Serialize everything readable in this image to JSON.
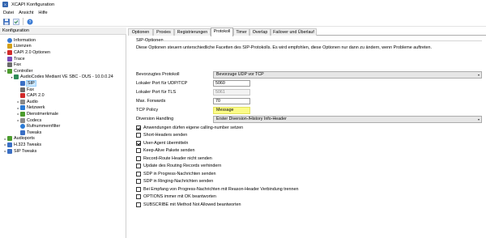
{
  "window": {
    "title": "XCAPI Konfiguration"
  },
  "menu": [
    "Datei",
    "Ansicht",
    "Hilfe"
  ],
  "toolbar": [
    "save-icon",
    "apply-icon",
    "help-icon"
  ],
  "left": {
    "header": "Konfiguration",
    "tree": [
      {
        "label": "Information",
        "icon": "info-icon",
        "color": "#3a7bd5"
      },
      {
        "label": "Lizenzen",
        "icon": "key-icon",
        "color": "#d4a017"
      },
      {
        "label": "CAPI 2.0 Optionen",
        "icon": "capi-icon",
        "color": "#d12a2a"
      },
      {
        "label": "Trace",
        "icon": "trace-icon",
        "color": "#7a4fb8"
      },
      {
        "label": "Fax",
        "icon": "fax-icon",
        "color": "#6d6d6d"
      },
      {
        "label": "Controller",
        "icon": "controller-icon",
        "color": "#4c9c2e"
      },
      {
        "label": "AudioCodes Mediant VE SBC - DUS - 10.0.0.24",
        "icon": "device-icon",
        "color": "#2e8b57"
      },
      {
        "label": "SIP",
        "icon": "sip-icon",
        "color": "#3a6fc4"
      },
      {
        "label": "Fax",
        "icon": "fax-icon",
        "color": "#6d6d6d"
      },
      {
        "label": "CAPI 2.0",
        "icon": "capi-icon",
        "color": "#d12a2a"
      },
      {
        "label": "Audio",
        "icon": "audio-icon",
        "color": "#8a8a8a"
      },
      {
        "label": "Netzwerk",
        "icon": "network-icon",
        "color": "#2b7bd6"
      },
      {
        "label": "Dienstmerkmale",
        "icon": "features-icon",
        "color": "#4c9c2e"
      },
      {
        "label": "Codecs",
        "icon": "codecs-icon",
        "color": "#8a8a8a"
      },
      {
        "label": "Rufnummernfilter",
        "icon": "filter-icon",
        "color": "#2b7bd6"
      },
      {
        "label": "Tweaks",
        "icon": "tweaks-icon",
        "color": "#3a6fc4"
      },
      {
        "label": "Audioports",
        "icon": "audioports-icon",
        "color": "#4c9c2e"
      },
      {
        "label": "H.323 Tweaks",
        "icon": "h323-icon",
        "color": "#3a6fc4"
      },
      {
        "label": "SIP Tweaks",
        "icon": "sip-tweaks-icon",
        "color": "#3a6fc4"
      }
    ]
  },
  "tabs": [
    "Optionen",
    "Proxies",
    "Registrierungen",
    "Protokoll",
    "Timer",
    "Overlap",
    "Failover und Überlauf"
  ],
  "active_tab": "Protokoll",
  "panel": {
    "section_title": "SIP-Optionen",
    "description": "Diese Optionen steuern unterschiedliche Facetten des SIP-Protokolls. Es wird empfohlen, diese Optionen nur dann zu ändern, wenn Probleme auftreten.",
    "fields": {
      "protocol_label": "Bevorzugtes Protokoll",
      "protocol_value": "Bevorzuge UDP vor TCP",
      "udp_tcp_port_label": "Lokaler Port für UDP/TCP",
      "udp_tcp_port_value": "5060",
      "tls_port_label": "Lokaler Port für TLS",
      "tls_port_value": "5061",
      "max_forwards_label": "Max. Forwards",
      "max_forwards_value": "70",
      "tcp_policy_label": "TCP Policy",
      "tcp_policy_value": "Message",
      "diversion_label": "Diversion Handling",
      "diversion_value": "Erster Diversion-/History Info-Header"
    },
    "checkboxes": [
      {
        "label": "Anwendungen dürfen eigene calling-number setzen",
        "checked": true
      },
      {
        "label": "Short-Headers senden",
        "checked": false
      },
      {
        "label": "User-Agent übermitteln",
        "checked": true
      },
      {
        "label": "Keep-Alive Pakete senden",
        "checked": false
      },
      {
        "label": "Record-Route Header nicht senden",
        "checked": false
      },
      {
        "label": "Update des Routing Records verhindern",
        "checked": false
      },
      {
        "label": "SDP in Progress-Nachrichten senden",
        "checked": false
      },
      {
        "label": "SDP in Ringing-Nachrichten senden",
        "checked": false
      },
      {
        "label": "Bei Empfang von Progress-Nachrichten mit Reason-Header Verbindung trennen",
        "checked": false
      },
      {
        "label": "OPTIONS immer mit OK beantworten",
        "checked": false
      },
      {
        "label": "SUBSCRIBE mit Method Not Allowed beantworten",
        "checked": false
      }
    ]
  },
  "colors": {
    "selection": "#cce8ff",
    "highlight": "#fbfb88"
  }
}
